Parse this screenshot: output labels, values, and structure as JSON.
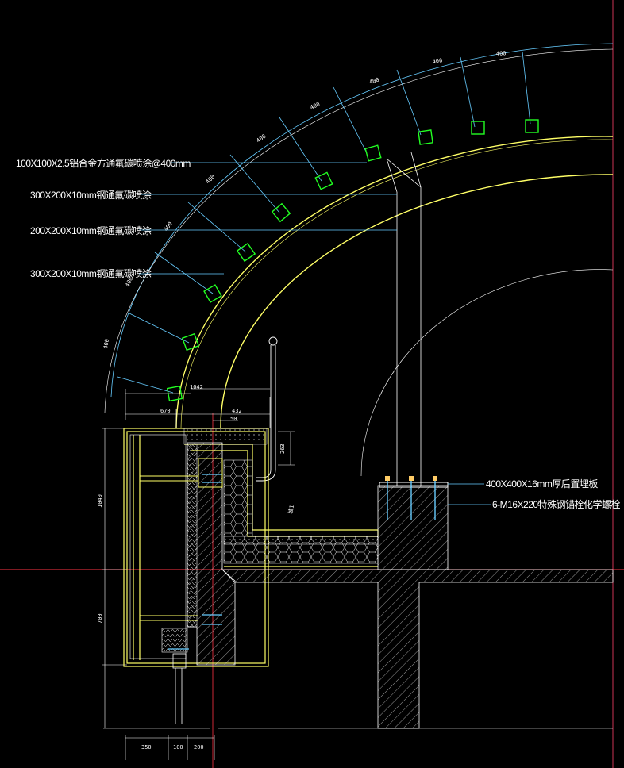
{
  "labels": {
    "tube": "100X100X2.5铝合金方通氟碳喷涂@400mm",
    "plate_300_top": "300X200X10mm钢通氟碳喷涂",
    "plate_200": "200X200X10mm钢通氟碳喷涂",
    "plate_300_bottom": "300X200X10mm钢通氟碳喷涂",
    "embed_plate": "400X400X16mm厚后置埋板",
    "anchor_bolt": "6-M16X220特殊钢锚栓化学螺栓"
  },
  "dims": {
    "arc_spacing": [
      "400",
      "400",
      "400",
      "400",
      "400",
      "400",
      "400",
      "400",
      "400"
    ],
    "d_1042": "1042",
    "d_670": "670",
    "d_432": "432",
    "d_50": "50",
    "d_263": "263",
    "d_1040": "1040",
    "d_700": "700",
    "bottom_350": "350",
    "bottom_100": "100",
    "bottom_200": "200",
    "slope": "坡1"
  },
  "colors": {
    "background": "#000000",
    "structure": "#ffffff",
    "cladding": "#ffff66",
    "tube_marker": "#22ff22",
    "dimension": "#66ccff",
    "reference_line": "#ff3344",
    "boundary": "#cc3355"
  }
}
